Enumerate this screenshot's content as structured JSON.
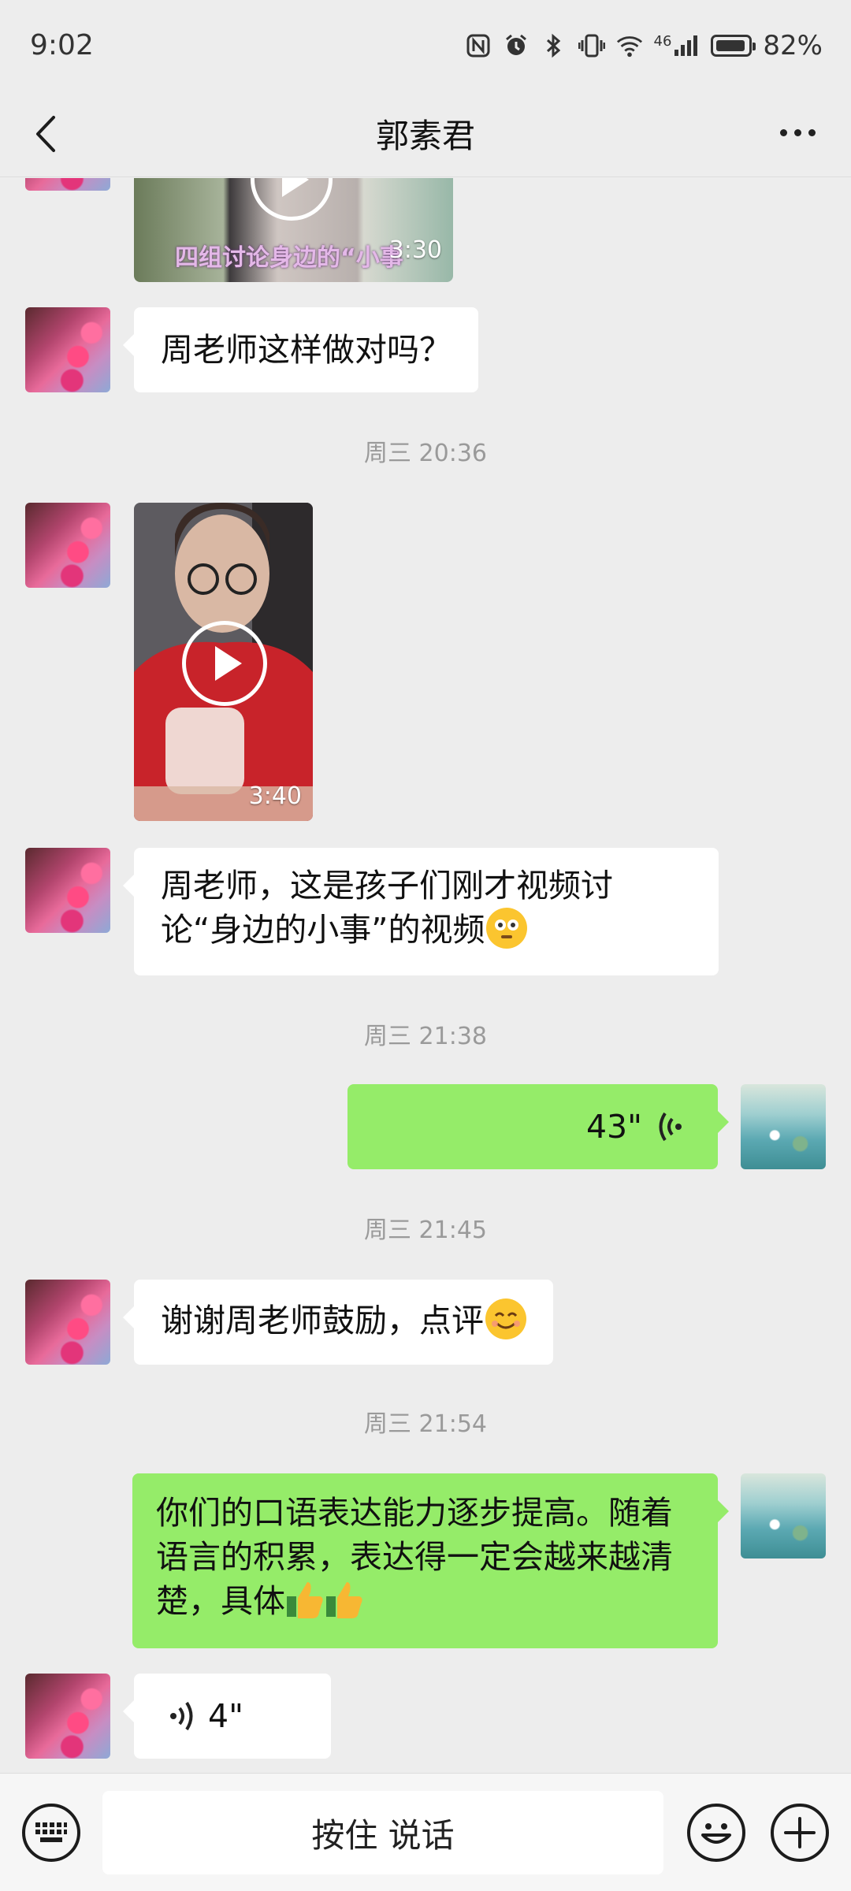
{
  "status": {
    "time": "9:02",
    "network": "46",
    "battery": "82%"
  },
  "header": {
    "title": "郭素君"
  },
  "messages": {
    "video1": {
      "caption": "四组讨论身边的“小事",
      "duration": "3:30"
    },
    "msg1": "周老师这样做对吗？",
    "ts1": "周三 20:36",
    "video2": {
      "duration": "3:40"
    },
    "msg2": "周老师，这是孩子们刚才视频讨论“身边的小事”的视频",
    "ts2": "周三 21:38",
    "voice_out": "43\"",
    "ts3": "周三 21:45",
    "msg3": "谢谢周老师鼓励，点评",
    "ts4": "周三 21:54",
    "msg4": "你们的口语表达能力逐步提高。随着语言的积累，表达得一定会越来越清楚，具体",
    "voice_in": "4\""
  },
  "input": {
    "talk_label": "按住 说话"
  },
  "colors": {
    "bg": "#ededed",
    "incoming": "#ffffff",
    "outgoing": "#95ec69",
    "timestamp": "#9a9a9a"
  },
  "icons": [
    "back-icon",
    "more-icon",
    "play-icon",
    "voice-wave-icon",
    "keyboard-icon",
    "emoji-icon",
    "plus-icon",
    "nfc-icon",
    "alarm-icon",
    "bluetooth-icon",
    "vibrate-icon",
    "wifi-icon",
    "signal-icon",
    "battery-icon"
  ]
}
